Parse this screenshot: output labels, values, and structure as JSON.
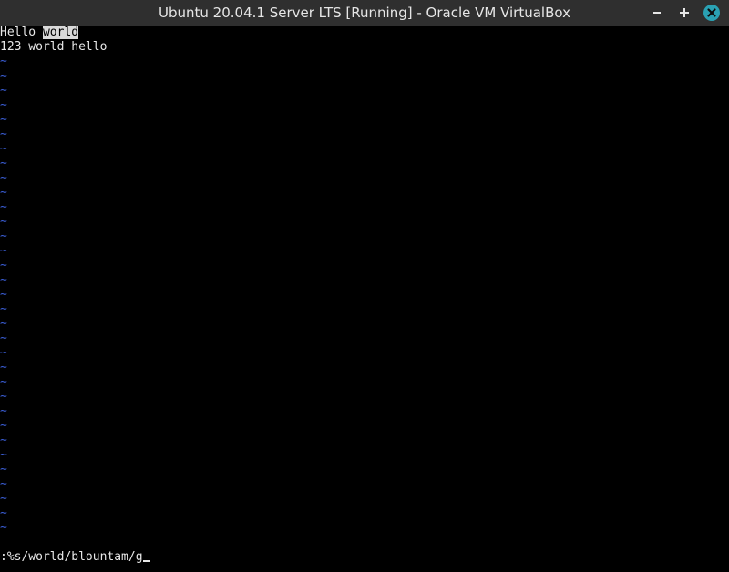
{
  "window": {
    "title": "Ubuntu 20.04.1 Server LTS [Running] - Oracle VM VirtualBox",
    "buttons": [
      {
        "name": "minimize",
        "icon": "minimize-icon"
      },
      {
        "name": "maximize",
        "icon": "maximize-icon"
      },
      {
        "name": "close",
        "icon": "close-icon"
      }
    ],
    "close_color": "#2aa1b3"
  },
  "editor": {
    "lines": [
      {
        "before": "Hello ",
        "highlight": "world",
        "after": ""
      },
      {
        "before": "123 world hello",
        "highlight": "",
        "after": ""
      }
    ],
    "tilde_char": "~",
    "tilde_color": "#3b5fd9",
    "command": ":%s/world/blountam/g"
  }
}
